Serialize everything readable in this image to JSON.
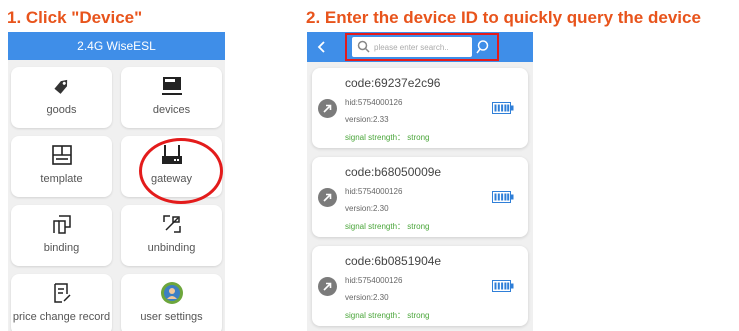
{
  "step1": {
    "title": "1. Click \"Device\""
  },
  "step2": {
    "title": "2. Enter the device ID to quickly query the device"
  },
  "left_app": {
    "header_title": "2.4G WiseESL",
    "menu": [
      {
        "label": "goods",
        "icon": "tag-icon"
      },
      {
        "label": "devices",
        "icon": "device-icon"
      },
      {
        "label": "template",
        "icon": "template-icon"
      },
      {
        "label": "gateway",
        "icon": "gateway-icon"
      },
      {
        "label": "binding",
        "icon": "binding-icon"
      },
      {
        "label": "unbinding",
        "icon": "unbinding-icon"
      },
      {
        "label": "price change record",
        "icon": "record-icon"
      },
      {
        "label": "user settings",
        "icon": "avatar-icon"
      }
    ]
  },
  "right_app": {
    "search": {
      "placeholder": "please enter search..",
      "value": ""
    },
    "devices": [
      {
        "code": "code:69237e2c96",
        "hid": "hid:5754000126",
        "version": "version:2.33",
        "signal": "signal strength： strong"
      },
      {
        "code": "code:b68050009e",
        "hid": "hid:5754000126",
        "version": "version:2.30",
        "signal": "signal strength： strong"
      },
      {
        "code": "code:6b0851904e",
        "hid": "hid:5754000126",
        "version": "version:2.30",
        "signal": "signal strength： strong"
      }
    ]
  },
  "colors": {
    "header_blue": "#3f8ee8",
    "step_title_orange": "#e8541c",
    "highlight_red": "#e31b1b",
    "signal_green": "#4aa63a",
    "battery_blue": "#2f7fd8"
  }
}
